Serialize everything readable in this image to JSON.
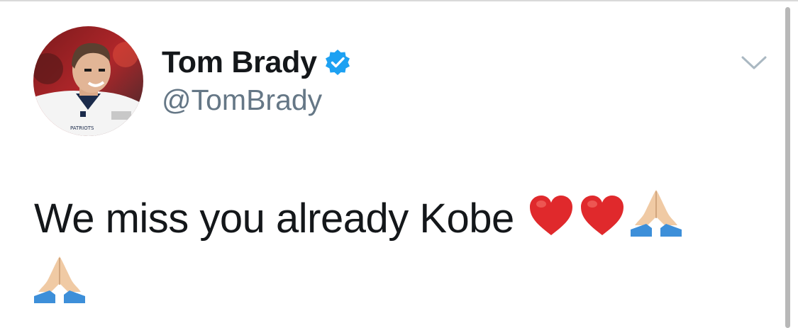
{
  "tweet": {
    "display_name": "Tom Brady",
    "handle": "@TomBrady",
    "verified": true,
    "text": "We miss you already Kobe",
    "emojis": [
      "red-heart",
      "red-heart",
      "folded-hands",
      "folded-hands"
    ]
  },
  "avatar": {
    "jersey_text": "PATRIOTS"
  },
  "colors": {
    "name": "#14171a",
    "handle": "#657786",
    "verified_badge": "#1da1f2",
    "heart": "#e0292c",
    "chevron": "#aab8c2"
  }
}
